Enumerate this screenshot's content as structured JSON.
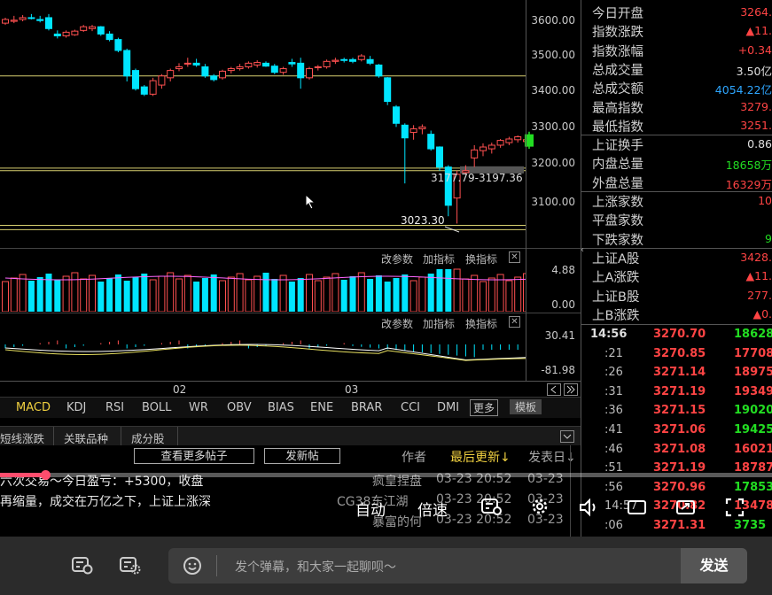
{
  "price_axis": [
    "3600.00",
    "3500.00",
    "3400.00",
    "3300.00",
    "3200.00",
    "3100.00"
  ],
  "annotations": {
    "range_label": "3177.79-3197.36",
    "low_label": "3023.30"
  },
  "vol_axis": [
    "4.88",
    "0.00"
  ],
  "macd_axis": [
    "30.41",
    "-81.98"
  ],
  "subbar_labels": {
    "params": "改参数",
    "add_indicator": "加指标",
    "switch_indicator": "换指标",
    "close": "✕"
  },
  "date_labels": [
    "02",
    "03"
  ],
  "indicator_tabs": [
    "MACD",
    "KDJ",
    "RSI",
    "BOLL",
    "WR",
    "OBV",
    "BIAS",
    "ENE",
    "BRAR",
    "CCI",
    "DMI"
  ],
  "more_label": "更多",
  "template_label": "模板",
  "bottom_tabs": [
    "短线涨跌",
    "关联品种",
    "成分股"
  ],
  "forum": {
    "view_more": "查看更多帖子",
    "new_post": "发新帖",
    "col_author": "作者",
    "col_last_update": "最后更新↓",
    "col_post_date": "发表日↓",
    "posts": [
      {
        "title": "六次交易～今日盈亏：+5300，收盘",
        "author": "疯皇捏盘",
        "update": "03-23 20:52",
        "date": "03-23"
      },
      {
        "title": "再缩量，成交在万亿之下，上证上涨深",
        "author": "CG38东江湖",
        "update": "03-23 20:52",
        "date": "03-23"
      },
      {
        "title": "",
        "author": "暴富的何",
        "update": "03-23 20:52",
        "date": "03-23"
      }
    ]
  },
  "quote": [
    {
      "label": "今日开盘",
      "value": "3264.",
      "color": "#ff4444"
    },
    {
      "label": "指数涨跌",
      "value": "▲11.",
      "color": "#ff4444"
    },
    {
      "label": "指数涨幅",
      "value": "+0.34",
      "color": "#ff4444"
    },
    {
      "label": "总成交量",
      "value": "3.50亿",
      "color": "#e0e0e0"
    },
    {
      "label": "总成交额",
      "value": "4054.22亿",
      "color": "#2ea6ff"
    },
    {
      "label": "最高指数",
      "value": "3279.",
      "color": "#ff4444"
    },
    {
      "label": "最低指数",
      "value": "3251.",
      "color": "#ff4444"
    },
    {
      "label": "上证换手",
      "value": "0.86",
      "color": "#e0e0e0"
    },
    {
      "label": "内盘总量",
      "value": "18658万",
      "color": "#22dd22"
    },
    {
      "label": "外盘总量",
      "value": "16329万",
      "color": "#ff4444"
    },
    {
      "label": "上涨家数",
      "value": "10",
      "color": "#ff4444"
    },
    {
      "label": "平盘家数",
      "value": "",
      "color": "#e0e0e0"
    },
    {
      "label": "下跌家数",
      "value": "9",
      "color": "#22dd22"
    },
    {
      "label": "上证A股",
      "value": "3428.",
      "color": "#ff4444"
    },
    {
      "label": "上A涨跌",
      "value": "▲11.",
      "color": "#ff4444"
    },
    {
      "label": "上证B股",
      "value": "277.",
      "color": "#ff4444"
    },
    {
      "label": "上B涨跌",
      "value": "▲0.",
      "color": "#ff4444"
    }
  ],
  "ticks": [
    {
      "time": "14:56",
      "price": "3270.70",
      "vol": "18628",
      "vcolor": "#22dd22"
    },
    {
      "time": ":21",
      "price": "3270.85",
      "vol": "17708",
      "vcolor": "#ff4444"
    },
    {
      "time": ":26",
      "price": "3271.14",
      "vol": "18975",
      "vcolor": "#ff4444"
    },
    {
      "time": ":31",
      "price": "3271.19",
      "vol": "19349",
      "vcolor": "#ff4444"
    },
    {
      "time": ":36",
      "price": "3271.15",
      "vol": "19020",
      "vcolor": "#22dd22"
    },
    {
      "time": ":41",
      "price": "3271.06",
      "vol": "19425",
      "vcolor": "#22dd22"
    },
    {
      "time": ":46",
      "price": "3271.08",
      "vol": "16021",
      "vcolor": "#ff4444"
    },
    {
      "time": ":51",
      "price": "3271.19",
      "vol": "18787",
      "vcolor": "#ff4444"
    },
    {
      "time": ":56",
      "price": "3270.96",
      "vol": "17853",
      "vcolor": "#22dd22"
    },
    {
      "time": "14:57",
      "price": "3270.82",
      "vol": "13478",
      "vcolor": "#ff4444"
    },
    {
      "time": ":06",
      "price": "3271.31",
      "vol": "3735",
      "vcolor": "#22dd22"
    }
  ],
  "player": {
    "auto_label": "自动",
    "speed_label": "倍速",
    "danmu_placeholder": "发个弹幕，和大家一起聊呗～",
    "send_label": "发送"
  },
  "candles": [
    [
      3590,
      3605,
      3585,
      3600
    ],
    [
      3595,
      3610,
      3590,
      3598
    ],
    [
      3600,
      3612,
      3595,
      3605
    ],
    [
      3605,
      3615,
      3600,
      3603
    ],
    [
      3600,
      3610,
      3592,
      3597
    ],
    [
      3605,
      3615,
      3570,
      3575
    ],
    [
      3560,
      3570,
      3548,
      3555
    ],
    [
      3555,
      3570,
      3550,
      3565
    ],
    [
      3558,
      3572,
      3555,
      3568
    ],
    [
      3570,
      3585,
      3566,
      3580
    ],
    [
      3575,
      3585,
      3568,
      3580
    ],
    [
      3580,
      3582,
      3555,
      3560
    ],
    [
      3560,
      3568,
      3540,
      3545
    ],
    [
      3545,
      3550,
      3510,
      3515
    ],
    [
      3515,
      3520,
      3430,
      3445
    ],
    [
      3460,
      3465,
      3405,
      3410
    ],
    [
      3415,
      3420,
      3390,
      3395
    ],
    [
      3395,
      3440,
      3390,
      3432
    ],
    [
      3420,
      3450,
      3410,
      3445
    ],
    [
      3440,
      3465,
      3430,
      3460
    ],
    [
      3465,
      3480,
      3458,
      3470
    ],
    [
      3478,
      3495,
      3470,
      3480
    ],
    [
      3480,
      3492,
      3470,
      3475
    ],
    [
      3470,
      3478,
      3440,
      3445
    ],
    [
      3445,
      3450,
      3430,
      3435
    ],
    [
      3440,
      3462,
      3435,
      3458
    ],
    [
      3460,
      3470,
      3452,
      3465
    ],
    [
      3465,
      3478,
      3460,
      3470
    ],
    [
      3470,
      3485,
      3465,
      3480
    ],
    [
      3475,
      3488,
      3468,
      3482
    ],
    [
      3480,
      3485,
      3470,
      3472
    ],
    [
      3472,
      3478,
      3450,
      3455
    ],
    [
      3455,
      3470,
      3448,
      3465
    ],
    [
      3482,
      3492,
      3470,
      3478
    ],
    [
      3480,
      3495,
      3410,
      3440
    ],
    [
      3440,
      3470,
      3435,
      3465
    ],
    [
      3468,
      3475,
      3460,
      3470
    ],
    [
      3470,
      3490,
      3465,
      3485
    ],
    [
      3485,
      3495,
      3478,
      3488
    ],
    [
      3490,
      3495,
      3482,
      3488
    ],
    [
      3490,
      3495,
      3480,
      3485
    ],
    [
      3490,
      3505,
      3485,
      3500
    ],
    [
      3490,
      3500,
      3475,
      3480
    ],
    [
      3475,
      3478,
      3440,
      3445
    ],
    [
      3440,
      3442,
      3365,
      3375
    ],
    [
      3360,
      3365,
      3305,
      3315
    ],
    [
      3310,
      3315,
      3150,
      3275
    ],
    [
      3290,
      3310,
      3270,
      3300
    ],
    [
      3300,
      3312,
      3285,
      3305
    ],
    [
      3285,
      3295,
      3240,
      3245
    ],
    [
      3250,
      3252,
      3185,
      3195
    ],
    [
      3195,
      3200,
      3060,
      3090
    ],
    [
      3110,
      3185,
      3040,
      3175
    ],
    [
      3180,
      3200,
      3175,
      3185
    ],
    [
      3220,
      3255,
      3195,
      3242
    ],
    [
      3240,
      3260,
      3225,
      3250
    ],
    [
      3245,
      3262,
      3232,
      3255
    ],
    [
      3255,
      3272,
      3248,
      3268
    ],
    [
      3262,
      3278,
      3255,
      3272
    ],
    [
      3270,
      3282,
      3262,
      3278
    ],
    [
      3265,
      3280,
      3250,
      3270
    ]
  ]
}
